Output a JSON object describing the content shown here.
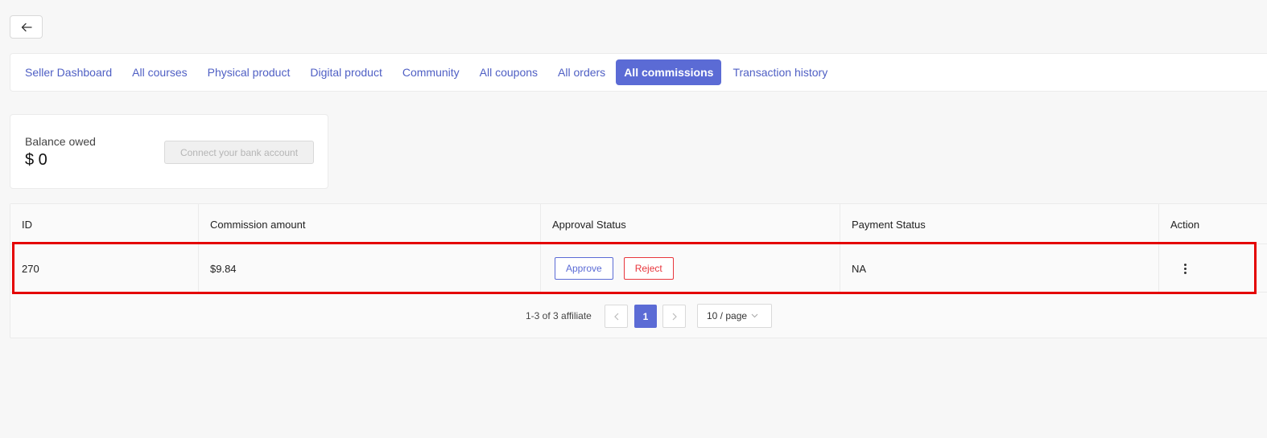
{
  "header": {
    "back_icon": "arrow-left-icon"
  },
  "nav": {
    "items": [
      {
        "label": "Seller Dashboard"
      },
      {
        "label": "All courses"
      },
      {
        "label": "Physical product"
      },
      {
        "label": "Digital product"
      },
      {
        "label": "Community"
      },
      {
        "label": "All coupons"
      },
      {
        "label": "All orders"
      },
      {
        "label": "All commissions",
        "active": true
      },
      {
        "label": "Transaction history"
      }
    ]
  },
  "balance": {
    "label": "Balance owed",
    "value": "$ 0",
    "connect_button": "Connect your bank account"
  },
  "table": {
    "columns": [
      "ID",
      "Commission amount",
      "Approval Status",
      "Payment Status",
      "Action"
    ],
    "rows": [
      {
        "id": "270",
        "commission_amount": "$9.84",
        "approve_label": "Approve",
        "reject_label": "Reject",
        "payment_status": "NA",
        "action_icon": "more-vertical-icon"
      }
    ]
  },
  "pagination": {
    "total_text": "1-3 of 3 affiliate",
    "current_page": "1",
    "page_size": "10 / page"
  },
  "colors": {
    "accent": "#5b6bd5",
    "reject": "#e8363c",
    "highlight": "#e40000"
  }
}
